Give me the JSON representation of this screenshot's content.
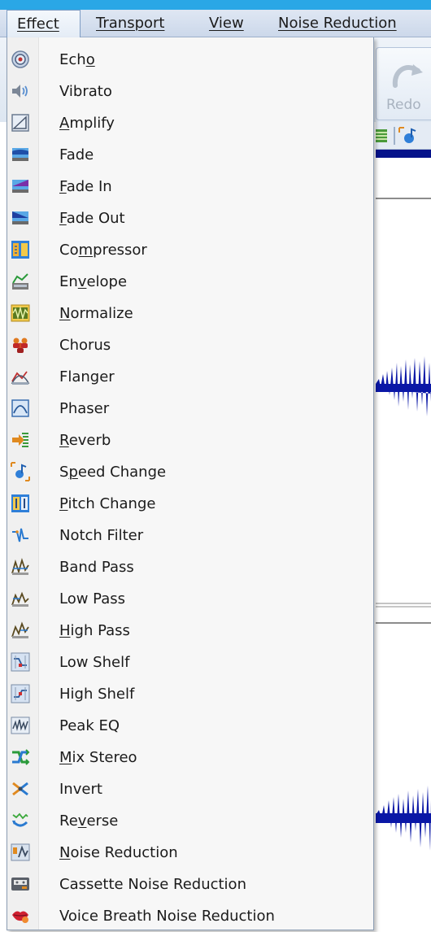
{
  "menubar": {
    "effect": "Effect",
    "transport": "Transport",
    "view": "View",
    "noise_reduction": "Noise Reduction"
  },
  "toolbar": {
    "redo_label": "Redo"
  },
  "menu": {
    "items": [
      {
        "pre": "Ech",
        "key": "o",
        "post": "",
        "icon": "echo-icon"
      },
      {
        "pre": "",
        "key": "",
        "post": "Vibrato",
        "icon": "speaker-icon"
      },
      {
        "pre": "",
        "key": "A",
        "post": "mplify",
        "icon": "amplify-icon"
      },
      {
        "pre": "",
        "key": "",
        "post": "Fade",
        "icon": "fade-icon"
      },
      {
        "pre": "",
        "key": "F",
        "post": "ade In",
        "icon": "fade-in-icon"
      },
      {
        "pre": "",
        "key": "F",
        "post": "ade Out",
        "icon": "fade-out-icon"
      },
      {
        "pre": "Co",
        "key": "m",
        "post": "pressor",
        "icon": "compressor-icon"
      },
      {
        "pre": "En",
        "key": "v",
        "post": "elope",
        "icon": "envelope-icon"
      },
      {
        "pre": "",
        "key": "N",
        "post": "ormalize",
        "icon": "normalize-icon"
      },
      {
        "pre": "",
        "key": "",
        "post": "Chorus",
        "icon": "chorus-icon"
      },
      {
        "pre": "",
        "key": "",
        "post": "Flanger",
        "icon": "flanger-icon"
      },
      {
        "pre": "",
        "key": "",
        "post": "Phaser",
        "icon": "phaser-icon"
      },
      {
        "pre": "",
        "key": "R",
        "post": "everb",
        "icon": "reverb-icon"
      },
      {
        "pre": "S",
        "key": "p",
        "post": "eed Change",
        "icon": "speed-change-icon"
      },
      {
        "pre": "",
        "key": "P",
        "post": "itch Change",
        "icon": "pitch-change-icon"
      },
      {
        "pre": "",
        "key": "",
        "post": "Notch Filter",
        "icon": "notch-filter-icon"
      },
      {
        "pre": "",
        "key": "",
        "post": "Band Pass",
        "icon": "band-pass-icon"
      },
      {
        "pre": "",
        "key": "",
        "post": "Low Pass",
        "icon": "low-pass-icon"
      },
      {
        "pre": "",
        "key": "H",
        "post": "igh Pass",
        "icon": "high-pass-icon"
      },
      {
        "pre": "",
        "key": "",
        "post": "Low Shelf",
        "icon": "low-shelf-icon"
      },
      {
        "pre": "",
        "key": "",
        "post": "High Shelf",
        "icon": "high-shelf-icon"
      },
      {
        "pre": "",
        "key": "",
        "post": "Peak EQ",
        "icon": "peak-eq-icon"
      },
      {
        "pre": "",
        "key": "M",
        "post": "ix Stereo",
        "icon": "mix-stereo-icon"
      },
      {
        "pre": "",
        "key": "",
        "post": "Invert",
        "icon": "invert-icon"
      },
      {
        "pre": "Re",
        "key": "v",
        "post": "erse",
        "icon": "reverse-icon"
      },
      {
        "pre": "",
        "key": "N",
        "post": "oise Reduction",
        "icon": "noise-reduction-icon"
      },
      {
        "pre": "",
        "key": "",
        "post": "Cassette Noise Reduction",
        "icon": "cassette-icon"
      },
      {
        "pre": "",
        "key": "",
        "post": "Voice Breath Noise Reduction",
        "icon": "lips-icon"
      }
    ]
  }
}
